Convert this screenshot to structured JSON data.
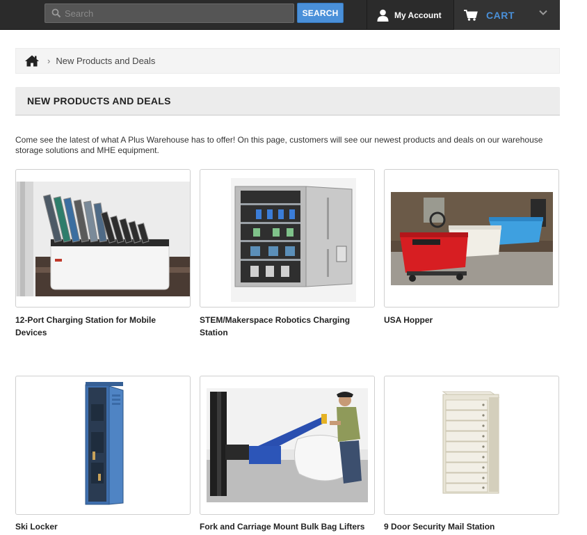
{
  "header": {
    "search_placeholder": "Search",
    "search_button": "SEARCH",
    "account_label": "My Account",
    "cart_label": "CART"
  },
  "breadcrumb": {
    "home_icon": "home-icon",
    "current": "New Products and Deals"
  },
  "page": {
    "heading": "NEW PRODUCTS AND DEALS",
    "intro": "Come see the latest of what A Plus Warehouse has to offer! On this page, customers will see our newest products and deals on our warehouse storage solutions and MHE equipment."
  },
  "products": [
    {
      "title": "12-Port Charging Station for Mobile Devices"
    },
    {
      "title": "STEM/Makerspace Robotics Charging Station"
    },
    {
      "title": "USA Hopper"
    },
    {
      "title": "Ski Locker"
    },
    {
      "title": "Fork and Carriage Mount Bulk Bag Lifters"
    },
    {
      "title": "9 Door Security Mail Station"
    }
  ],
  "colors": {
    "topbar": "#2b2b2b",
    "accent": "#4a90d9",
    "panel": "#ececec"
  }
}
